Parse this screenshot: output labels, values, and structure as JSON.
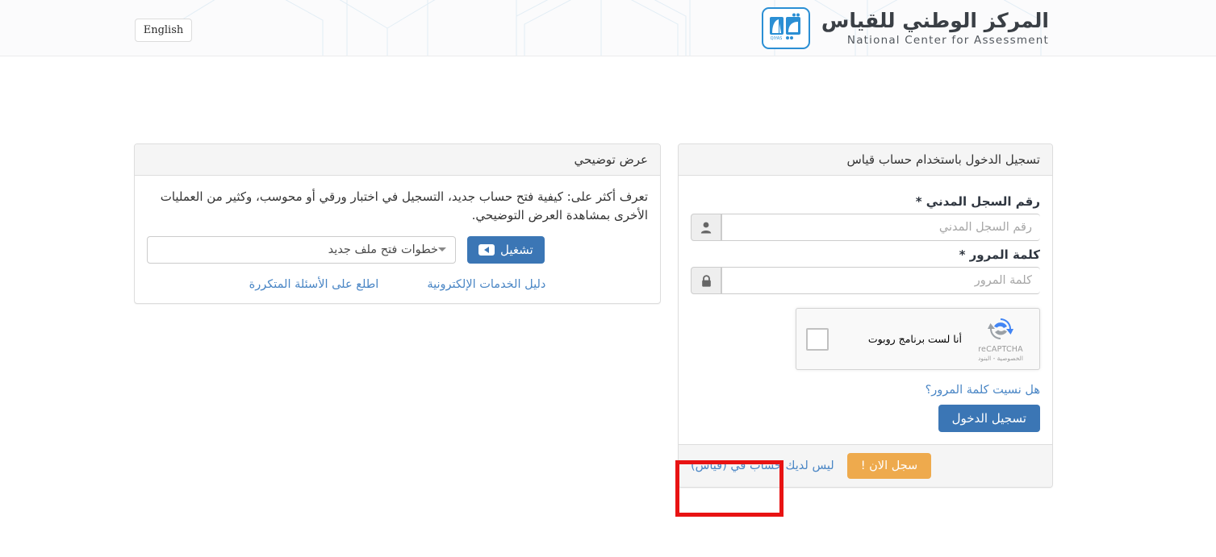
{
  "header": {
    "lang_button": "English",
    "brand_ar": "المركز الوطني للقياس",
    "brand_en": "National Center for Assessment",
    "logo_alt": "QIYAS"
  },
  "login_panel": {
    "title": "تسجيل الدخول باستخدام حساب قياس",
    "id_label": "رقم السجل المدني *",
    "id_placeholder": "رقم السجل المدني",
    "id_value": "",
    "id_icon": "user-icon",
    "password_label": "كلمة المرور *",
    "password_placeholder": "كلمة المرور",
    "password_value": "",
    "password_icon": "lock-icon",
    "recaptcha": {
      "label": "أنا لست برنامج روبوت",
      "brand": "reCAPTCHA",
      "links": "الخصوصية - البنود",
      "checked": false
    },
    "forgot_password": "هل نسيت كلمة المرور؟",
    "submit_label": "تسجيل الدخول",
    "footer_text": "ليس لديك حساب في (قياس)",
    "register_label": "سجل الان !"
  },
  "demo_panel": {
    "title": "عرض توضيحي",
    "description": "تعرف أكثر على: كيفية فتح حساب جديد، التسجيل في اختبار ورقي أو محوسب، وكثير من العمليات الأخرى بمشاهدة العرض التوضيحي.",
    "select_value": "خطوات فتح ملف جديد",
    "select_options": [
      "خطوات فتح ملف جديد"
    ],
    "play_label": "تشغيل",
    "play_icon": "youtube-play-icon",
    "link_faq": "اطلع على الأسئلة المتكررة",
    "link_guide": "دليل الخدمات الإلكترونية"
  },
  "annotation": {
    "target": "سجل الان !",
    "color": "#e81313"
  },
  "colors": {
    "primary_blue": "#3b76b5",
    "link_blue": "#4a86c5",
    "warning_orange": "#eeaa4d",
    "logo_blue": "#2b8fd4",
    "panel_gray": "#f5f5f5",
    "border_gray": "#dddddd",
    "annotation_red": "#e81313"
  }
}
